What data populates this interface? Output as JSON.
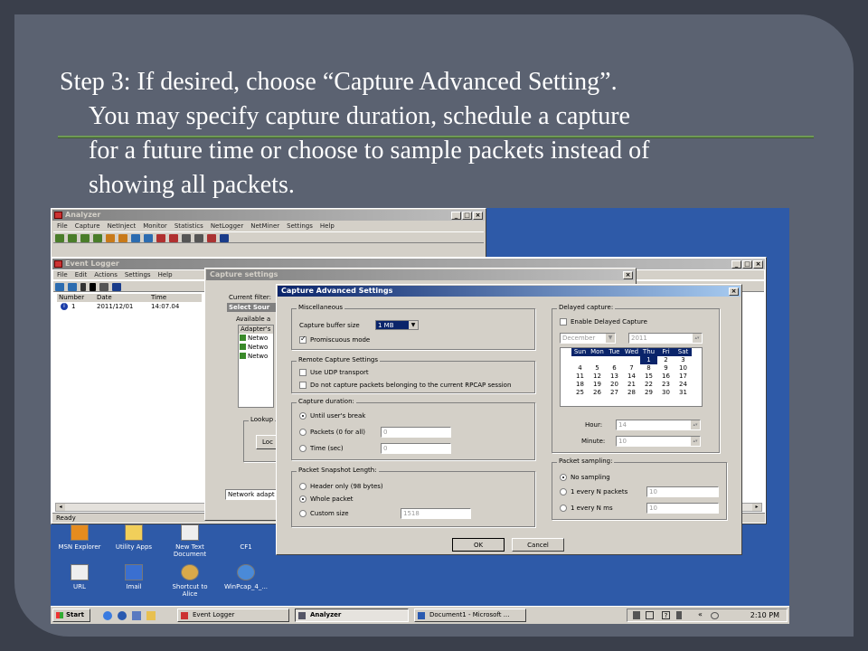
{
  "slide": {
    "line1": "Step 3: If desired, choose “Capture Advanced Setting”.",
    "line2": "You may specify capture duration, schedule a capture",
    "line3": "for a future time or choose to sample packets instead of",
    "line4": "showing all packets."
  },
  "analyzer": {
    "title": "Analyzer",
    "menu": [
      "File",
      "Capture",
      "NetInject",
      "Monitor",
      "Statistics",
      "NetLogger",
      "NetMiner",
      "Settings",
      "Help"
    ]
  },
  "event_logger": {
    "title": "Event Logger",
    "menu": [
      "File",
      "Edit",
      "Actions",
      "Settings",
      "Help"
    ],
    "columns": [
      "Number",
      "Date",
      "Time"
    ],
    "rows": [
      {
        "number": "1",
        "date": "2011/12/01",
        "time": "14:07.04"
      }
    ],
    "status": "Ready"
  },
  "capture_settings": {
    "title": "Capture settings",
    "current_filter": "Current filter:",
    "select_source": "Select Sour",
    "available": "Available a",
    "adapters_header": "Adapter's",
    "adapters": [
      "Netwo",
      "Netwo",
      "Netwo"
    ],
    "lookup": "Lookup",
    "lookup_button": "Loc",
    "network_adapter": "Network adapt"
  },
  "advanced": {
    "title": "Capture Advanced Settings",
    "misc": {
      "legend": "Miscellaneous",
      "buffer_label": "Capture buffer size",
      "buffer_value": "1 MB",
      "promiscuous": "Promiscuous mode"
    },
    "remote": {
      "legend": "Remote Capture Settings",
      "udp": "Use UDP transport",
      "no_rpcap": "Do not capture packets belonging to the current RPCAP session"
    },
    "duration": {
      "legend": "Capture duration:",
      "until_break": "Until user's break",
      "packets": "Packets (0 for all)",
      "packets_value": "0",
      "time": "Time (sec)",
      "time_value": "0"
    },
    "snapshot": {
      "legend": "Packet Snapshot Length:",
      "header_only": "Header only (98 bytes)",
      "whole": "Whole packet",
      "custom": "Custom size",
      "custom_value": "1518"
    },
    "delayed": {
      "legend": "Delayed capture:",
      "enable": "Enable Delayed Capture",
      "month": "December",
      "year": "2011",
      "hour_label": "Hour:",
      "hour": "14",
      "minute_label": "Minute:",
      "minute": "10"
    },
    "calendar": {
      "days": [
        "Sun",
        "Mon",
        "Tue",
        "Wed",
        "Thu",
        "Fri",
        "Sat"
      ],
      "weeks": [
        [
          "",
          "",
          "",
          "",
          "1",
          "2",
          "3"
        ],
        [
          "4",
          "5",
          "6",
          "7",
          "8",
          "9",
          "10"
        ],
        [
          "11",
          "12",
          "13",
          "14",
          "15",
          "16",
          "17"
        ],
        [
          "18",
          "19",
          "20",
          "21",
          "22",
          "23",
          "24"
        ],
        [
          "25",
          "26",
          "27",
          "28",
          "29",
          "30",
          "31"
        ]
      ]
    },
    "sampling": {
      "legend": "Packet sampling:",
      "none": "No sampling",
      "n_packets": "1 every N packets",
      "n_packets_value": "10",
      "n_ms": "1 every N ms",
      "n_ms_value": "10"
    },
    "ok": "OK",
    "cancel": "Cancel"
  },
  "desktop": {
    "row1": [
      "MSN Explorer",
      "Utility Apps",
      "New Text Document",
      "CF1"
    ],
    "row2": [
      "URL",
      "Imail",
      "Shortcut to Alice",
      "WinPcap_4_..."
    ]
  },
  "taskbar": {
    "start": "Start",
    "tasks": [
      "Event Logger",
      "Analyzer",
      "Document1 - Microsoft ..."
    ],
    "clock": "2:10 PM"
  },
  "colors": {
    "titlebar": "#0a246a",
    "desktop": "#2e5aa8",
    "slide_bg": "#5b6271"
  }
}
